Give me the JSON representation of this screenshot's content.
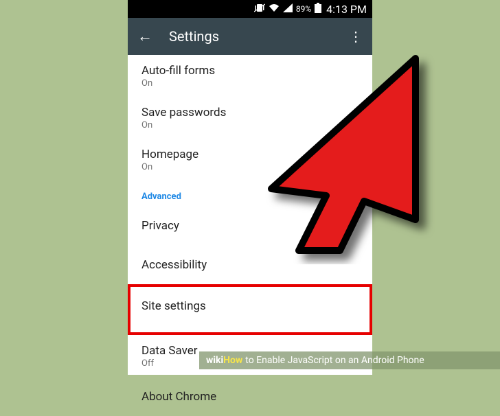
{
  "status": {
    "battery_pct": "89%",
    "time": "4:13 PM"
  },
  "appbar": {
    "title": "Settings"
  },
  "items": {
    "autofill": {
      "title": "Auto-fill forms",
      "sub": "On"
    },
    "savepw": {
      "title": "Save passwords",
      "sub": "On"
    },
    "homepage": {
      "title": "Homepage",
      "sub": "On"
    },
    "advanced_header": "Advanced",
    "privacy": {
      "title": "Privacy"
    },
    "accessibility": {
      "title": "Accessibility"
    },
    "sitesettings": {
      "title": "Site settings"
    },
    "datasaver": {
      "title": "Data Saver",
      "sub": "Off"
    },
    "aboutchrome": {
      "title": "About Chrome"
    }
  },
  "watermark": {
    "brand1": "wiki",
    "brand2": "How",
    "text": " to Enable JavaScript on an Android Phone"
  }
}
